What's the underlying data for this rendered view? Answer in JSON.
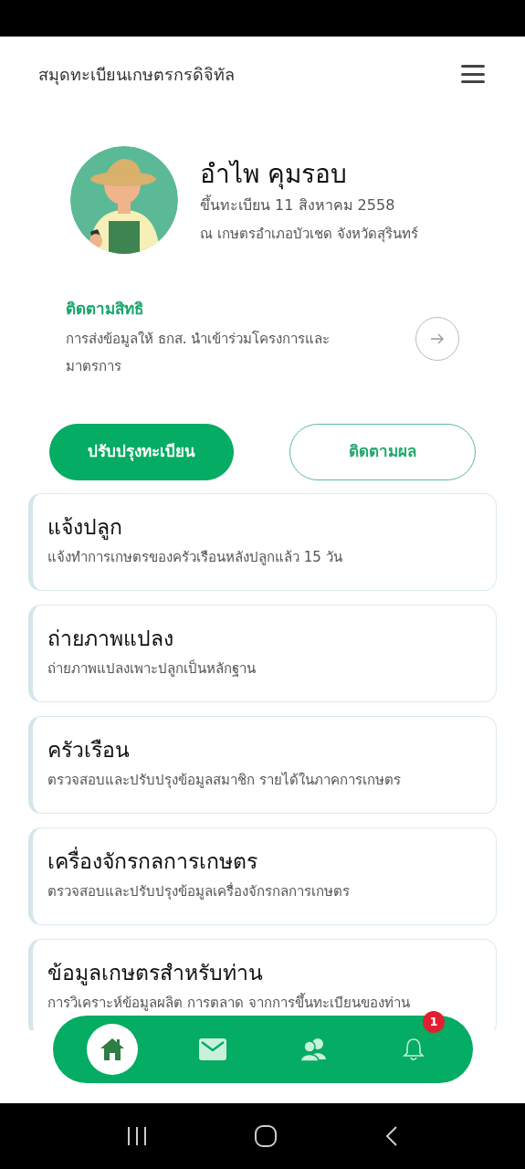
{
  "app_bar": {
    "title": "สมุดทะเบียนเกษตรกรดิจิทัล"
  },
  "profile": {
    "name": "อำไพ คุมรอบ",
    "registered": "ขึ้นทะเบียน 11 สิงหาคม 2558",
    "office": "ณ เกษตรอำเภอบัวเชด จังหวัดสุรินทร์"
  },
  "rights": {
    "title": "ติดตามสิทธิ",
    "description": "การส่งข้อมูลให้ ธกส. นำเข้าร่วมโครงการและมาตรการ"
  },
  "actions": [
    {
      "label": "ปรับปรุงทะเบียน",
      "kind": "primary"
    },
    {
      "label": "ติดตามผล",
      "kind": "outline"
    }
  ],
  "menu": [
    {
      "title": "แจ้งปลูก",
      "description": "แจ้งทำการเกษตรของครัวเรือนหลังปลูกแล้ว 15 วัน"
    },
    {
      "title": "ถ่ายภาพแปลง",
      "description": "ถ่ายภาพแปลงเพาะปลูกเป็นหลักฐาน"
    },
    {
      "title": "ครัวเรือน",
      "description": "ตรวจสอบและปรับปรุงข้อมูลสมาชิก รายได้ในภาคการเกษตร"
    },
    {
      "title": "เครื่องจักรกลการเกษตร",
      "description": "ตรวจสอบและปรับปรุงข้อมูลเครื่องจักรกลการเกษตร"
    },
    {
      "title": "ข้อมูลเกษตรสำหรับท่าน",
      "description": "การวิเคราะห์ข้อมูลผลิต การตลาด จากการขึ้นทะเบียนของท่าน"
    }
  ],
  "bottom_nav": [
    {
      "kind": "home",
      "selected": true
    },
    {
      "kind": "mail",
      "selected": false
    },
    {
      "kind": "people",
      "selected": false
    },
    {
      "kind": "bell",
      "selected": false,
      "badge": "1"
    }
  ]
}
